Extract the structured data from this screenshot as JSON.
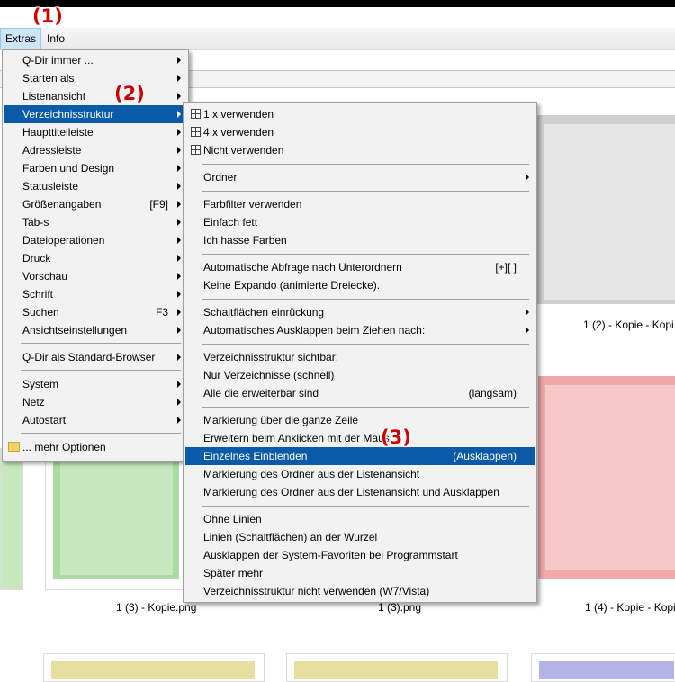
{
  "menubar": {
    "extras": "Extras",
    "info": "Info"
  },
  "annotations": [
    "(1)",
    "(2)",
    "(3)"
  ],
  "extras_menu": {
    "items": [
      {
        "label": "Q-Dir immer ...",
        "submenu": true
      },
      {
        "label": "Starten als",
        "submenu": true
      },
      {
        "label": "Listenansicht",
        "submenu": true
      },
      {
        "label": "Verzeichnisstruktur",
        "submenu": true,
        "highlighted": true
      },
      {
        "label": "Haupttitelleiste",
        "submenu": true
      },
      {
        "label": "Adressleiste",
        "submenu": true
      },
      {
        "label": "Farben und Design",
        "submenu": true
      },
      {
        "label": "Statusleiste",
        "submenu": true
      },
      {
        "label": "Größenangaben",
        "shortcut": "[F9]",
        "submenu": true
      },
      {
        "label": "Tab-s",
        "submenu": true
      },
      {
        "label": "Dateioperationen",
        "submenu": true
      },
      {
        "label": "Druck",
        "submenu": true
      },
      {
        "label": "Vorschau",
        "submenu": true
      },
      {
        "label": "Schrift",
        "submenu": true
      },
      {
        "label": "Suchen",
        "shortcut": "F3",
        "submenu": true
      },
      {
        "label": "Ansichtseinstellungen",
        "submenu": true
      },
      {
        "label": "Q-Dir als Standard-Browser",
        "submenu": true
      },
      {
        "label": "System",
        "submenu": true
      },
      {
        "label": "Netz",
        "submenu": true
      },
      {
        "label": "Autostart",
        "submenu": true
      },
      {
        "label": "... mehr Optionen",
        "icon": "folder-icon"
      }
    ]
  },
  "verzeichnis_menu": {
    "items": [
      {
        "label": "1 x verwenden",
        "icon": "grid-icon"
      },
      {
        "label": "4 x verwenden",
        "icon": "grid-icon"
      },
      {
        "label": "Nicht verwenden",
        "icon": "grid-icon"
      },
      {
        "label": "Ordner",
        "submenu": true
      },
      {
        "label": "Farbfilter verwenden"
      },
      {
        "label": "Einfach fett"
      },
      {
        "label": "Ich hasse Farben"
      },
      {
        "label": "Automatische Abfrage nach Unterordnern",
        "shortcut": "[+][ ]"
      },
      {
        "label": "Keine Expando (animierte Dreiecke)."
      },
      {
        "label": "Schaltflächen einrückung",
        "submenu": true
      },
      {
        "label": "Automatisches Ausklappen beim Ziehen nach:",
        "submenu": true
      },
      {
        "label": "Verzeichnisstruktur sichtbar:"
      },
      {
        "label": "Nur Verzeichnisse (schnell)"
      },
      {
        "label": "Alle die erweiterbar sind",
        "shortcut": "(langsam)"
      },
      {
        "label": "Markierung über die ganze Zeile"
      },
      {
        "label": "Erweitern beim Anklicken mit der Maus"
      },
      {
        "label": "Einzelnes Einblenden",
        "shortcut": "(Ausklappen)",
        "highlighted": true
      },
      {
        "label": "Markierung des Ordner aus der Listenansicht"
      },
      {
        "label": "Markierung des Ordner aus der Listenansicht und Ausklappen"
      },
      {
        "label": "Ohne Linien"
      },
      {
        "label": "Linien (Schaltflächen) an der Wurzel"
      },
      {
        "label": "Ausklappen der System-Favoriten bei Programmstart"
      },
      {
        "label": "Später mehr"
      },
      {
        "label": "Verzeichnisstruktur nicht verwenden (W7/Vista)"
      }
    ]
  },
  "thumbnails": [
    {
      "caption": "1 (2) - Kopie - Kopi",
      "color": "#b3b3b3"
    },
    {
      "caption": "1 (3) - Kopie.png",
      "color": "#a8dca0"
    },
    {
      "caption": "1 (3).png",
      "color": "#a8dca0"
    },
    {
      "caption": "1 (4) - Kopie - Kopi",
      "color": "#f0a8a8"
    },
    {
      "caption": "",
      "color": "#e6dfa0"
    },
    {
      "caption": "",
      "color": "#b3b3e6"
    }
  ]
}
